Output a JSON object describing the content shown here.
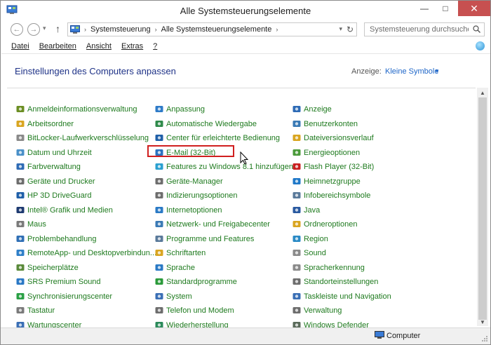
{
  "window": {
    "title": "Alle Systemsteuerungselemente",
    "minimize_glyph": "—",
    "maximize_glyph": "□",
    "close_glyph": "✕"
  },
  "navigation": {
    "back_glyph": "←",
    "forward_glyph": "→",
    "history_glyph": "▾",
    "up_glyph": "↑",
    "breadcrumbs": [
      "Systemsteuerung",
      "Alle Systemsteuerungselemente"
    ],
    "crumb_separator": "›",
    "dropdown_glyph": "▾",
    "refresh_glyph": "↻",
    "search_placeholder": "Systemsteuerung durchsuchen"
  },
  "menu": {
    "items": [
      "Datei",
      "Bearbeiten",
      "Ansicht",
      "Extras",
      "?"
    ]
  },
  "header": {
    "title": "Einstellungen des Computers anpassen",
    "view_label": "Anzeige:",
    "view_value": "Kleine Symbole",
    "view_caret": "▼"
  },
  "columns": [
    [
      {
        "label": "Anmeldeinformationsverwaltung",
        "icon": "credential-icon",
        "color": "#6b8e23"
      },
      {
        "label": "Arbeitsordner",
        "icon": "work-folders-icon",
        "color": "#d9a520"
      },
      {
        "label": "BitLocker-Laufwerkverschlüsselung",
        "icon": "bitlocker-icon",
        "color": "#8a8a8a"
      },
      {
        "label": "Datum und Uhrzeit",
        "icon": "clock-icon",
        "color": "#4a90c8"
      },
      {
        "label": "Farbverwaltung",
        "icon": "color-management-icon",
        "color": "#2e6bb5"
      },
      {
        "label": "Geräte und Drucker",
        "icon": "printer-icon",
        "color": "#6d6d6d"
      },
      {
        "label": "HP 3D DriveGuard",
        "icon": "hp-driveguard-icon",
        "color": "#1f5fa8"
      },
      {
        "label": "Intel® Grafik und Medien",
        "icon": "intel-graphics-icon",
        "color": "#1e3a70"
      },
      {
        "label": "Maus",
        "icon": "mouse-icon",
        "color": "#7a7a7a"
      },
      {
        "label": "Problembehandlung",
        "icon": "troubleshooting-icon",
        "color": "#2f6fb5"
      },
      {
        "label": "RemoteApp- und Desktopverbindun...",
        "icon": "remoteapp-icon",
        "color": "#2f7fc8"
      },
      {
        "label": "Speicherplätze",
        "icon": "storage-spaces-icon",
        "color": "#5a8a3a"
      },
      {
        "label": "SRS Premium Sound",
        "icon": "srs-sound-icon",
        "color": "#2a78c5"
      },
      {
        "label": "Synchronisierungscenter",
        "icon": "sync-center-icon",
        "color": "#2aa045"
      },
      {
        "label": "Tastatur",
        "icon": "keyboard-icon",
        "color": "#7a7a7a"
      },
      {
        "label": "Wartungscenter",
        "icon": "action-center-flag-icon",
        "color": "#3a6fb5"
      }
    ],
    [
      {
        "label": "Anpassung",
        "icon": "personalization-icon",
        "color": "#2e7bc8"
      },
      {
        "label": "Automatische Wiedergabe",
        "icon": "autoplay-icon",
        "color": "#2e8a4a"
      },
      {
        "label": "Center für erleichterte Bedienung",
        "icon": "ease-of-access-icon",
        "color": "#1f5fa8"
      },
      {
        "label": "E-Mail (32-Bit)",
        "icon": "mail-icon",
        "color": "#2a72c0"
      },
      {
        "label": "Features zu Windows 8.1 hinzufügen",
        "icon": "add-features-icon",
        "color": "#2aa0d0"
      },
      {
        "label": "Geräte-Manager",
        "icon": "device-manager-icon",
        "color": "#6d6d6d"
      },
      {
        "label": "Indizierungsoptionen",
        "icon": "indexing-icon",
        "color": "#6d6d6d"
      },
      {
        "label": "Internetoptionen",
        "icon": "internet-options-icon",
        "color": "#2a7ac5"
      },
      {
        "label": "Netzwerk- und Freigabecenter",
        "icon": "network-icon",
        "color": "#3a7ab5"
      },
      {
        "label": "Programme und Features",
        "icon": "programs-icon",
        "color": "#5a7a9a"
      },
      {
        "label": "Schriftarten",
        "icon": "fonts-icon",
        "color": "#d9a520"
      },
      {
        "label": "Sprache",
        "icon": "language-icon",
        "color": "#2a7ac5"
      },
      {
        "label": "Standardprogramme",
        "icon": "default-programs-icon",
        "color": "#2a9a3a"
      },
      {
        "label": "System",
        "icon": "system-icon",
        "color": "#3a6fb5"
      },
      {
        "label": "Telefon und Modem",
        "icon": "phone-modem-icon",
        "color": "#6d6d6d"
      },
      {
        "label": "Wiederherstellung",
        "icon": "recovery-icon",
        "color": "#2a8a5a"
      }
    ],
    [
      {
        "label": "Anzeige",
        "icon": "display-icon",
        "color": "#2e6bb5"
      },
      {
        "label": "Benutzerkonten",
        "icon": "user-accounts-icon",
        "color": "#3a7ab5"
      },
      {
        "label": "Dateiversionsverlauf",
        "icon": "file-history-icon",
        "color": "#d9a520"
      },
      {
        "label": "Energieoptionen",
        "icon": "power-options-icon",
        "color": "#4a9a3a"
      },
      {
        "label": "Flash Player (32-Bit)",
        "icon": "flash-player-icon",
        "color": "#c81e1e"
      },
      {
        "label": "Heimnetzgruppe",
        "icon": "homegroup-icon",
        "color": "#1f78c8"
      },
      {
        "label": "Infobereichsymbole",
        "icon": "notification-icons-icon",
        "color": "#5a7a9a"
      },
      {
        "label": "Java",
        "icon": "java-icon",
        "color": "#2a5aa0"
      },
      {
        "label": "Ordneroptionen",
        "icon": "folder-options-icon",
        "color": "#d9a520"
      },
      {
        "label": "Region",
        "icon": "region-icon",
        "color": "#2a8ac5"
      },
      {
        "label": "Sound",
        "icon": "sound-icon",
        "color": "#8a8a8a"
      },
      {
        "label": "Spracherkennung",
        "icon": "speech-recognition-icon",
        "color": "#8a8a8a"
      },
      {
        "label": "Standorteinstellungen",
        "icon": "location-icon",
        "color": "#6d6d6d"
      },
      {
        "label": "Taskleiste und Navigation",
        "icon": "taskbar-icon",
        "color": "#3a6fb5"
      },
      {
        "label": "Verwaltung",
        "icon": "admin-tools-icon",
        "color": "#6d6d6d"
      },
      {
        "label": "Windows Defender",
        "icon": "defender-icon",
        "color": "#5a6a5a"
      }
    ]
  ],
  "scrollbar": {
    "up_glyph": "▲",
    "down_glyph": "▼"
  },
  "status": {
    "text": "Computer"
  },
  "colors": {
    "item_link": "#1e7a1e",
    "title_blue": "#1e3287",
    "view_link": "#1e66c8",
    "highlight_red": "#d01f1f",
    "close_red": "#c75050"
  }
}
